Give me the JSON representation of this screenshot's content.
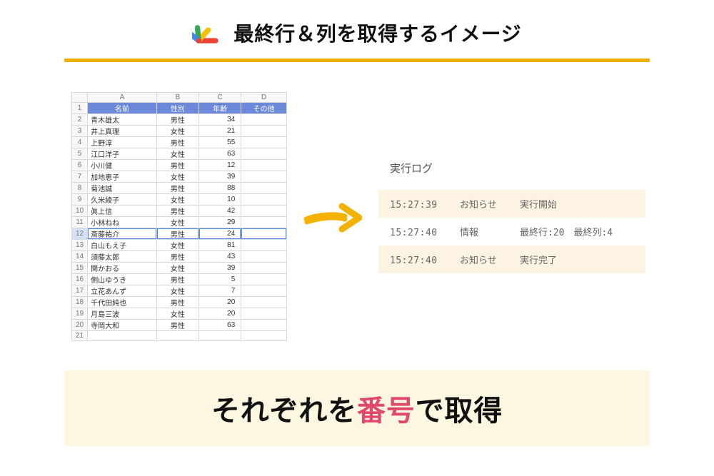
{
  "title": "最終行＆列を取得するイメージ",
  "sheet": {
    "columns": [
      "A",
      "B",
      "C",
      "D"
    ],
    "header": {
      "c1": "名前",
      "c2": "性別",
      "c3": "年齢",
      "c4": "その他"
    },
    "rows": [
      {
        "n": "2",
        "name": "青木雄太",
        "sex": "男性",
        "age": "34"
      },
      {
        "n": "3",
        "name": "井上真理",
        "sex": "女性",
        "age": "21"
      },
      {
        "n": "4",
        "name": "上野淳",
        "sex": "男性",
        "age": "55"
      },
      {
        "n": "5",
        "name": "江口洋子",
        "sex": "女性",
        "age": "63"
      },
      {
        "n": "6",
        "name": "小川健",
        "sex": "男性",
        "age": "12"
      },
      {
        "n": "7",
        "name": "加地恵子",
        "sex": "女性",
        "age": "39"
      },
      {
        "n": "8",
        "name": "菊池誠",
        "sex": "男性",
        "age": "88"
      },
      {
        "n": "9",
        "name": "久米綾子",
        "sex": "女性",
        "age": "10"
      },
      {
        "n": "10",
        "name": "眞上信",
        "sex": "男性",
        "age": "42"
      },
      {
        "n": "11",
        "name": "小林ねね",
        "sex": "女性",
        "age": "29"
      },
      {
        "n": "12",
        "name": "斎藤祐介",
        "sex": "男性",
        "age": "24",
        "selected": true
      },
      {
        "n": "13",
        "name": "白山もえ子",
        "sex": "女性",
        "age": "81"
      },
      {
        "n": "14",
        "name": "須藤太郎",
        "sex": "男性",
        "age": "43"
      },
      {
        "n": "15",
        "name": "関かおる",
        "sex": "女性",
        "age": "39"
      },
      {
        "n": "16",
        "name": "側山ゆうき",
        "sex": "男性",
        "age": "5"
      },
      {
        "n": "17",
        "name": "立花あんず",
        "sex": "女性",
        "age": "7"
      },
      {
        "n": "18",
        "name": "千代田純也",
        "sex": "男性",
        "age": "20"
      },
      {
        "n": "19",
        "name": "月島三波",
        "sex": "女性",
        "age": "20"
      },
      {
        "n": "20",
        "name": "寺岡大和",
        "sex": "男性",
        "age": "63"
      }
    ],
    "empty_row_idx": "21"
  },
  "log": {
    "title": "実行ログ",
    "entries": [
      {
        "time": "15:27:39",
        "level": "お知らせ",
        "msg": "実行開始",
        "highlight": true
      },
      {
        "time": "15:27:40",
        "level": "情報",
        "msg": "最終行:20　最終列:4",
        "highlight": false
      },
      {
        "time": "15:27:40",
        "level": "お知らせ",
        "msg": "実行完了",
        "highlight": true
      }
    ]
  },
  "footer": {
    "pre": "それぞれを",
    "em": "番号",
    "post": "で取得"
  }
}
